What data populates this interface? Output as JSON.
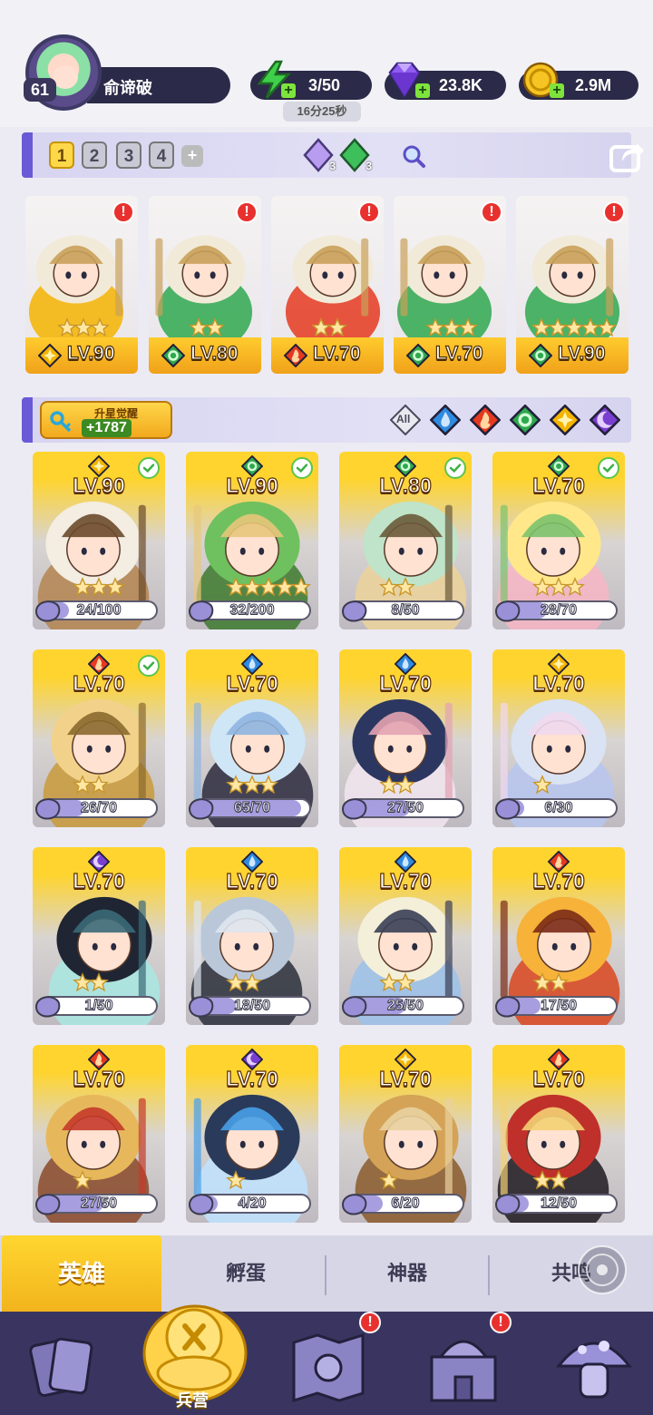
{
  "player": {
    "level": "61",
    "name": "俞谛破"
  },
  "resources": {
    "energy": "3/50",
    "energy_timer": "16分25秒",
    "gems": "23.8K",
    "gold": "2.9M"
  },
  "team_tabs": [
    "1",
    "2",
    "3",
    "4"
  ],
  "team_add_label": "+",
  "gem_badges": {
    "purple": "3",
    "green": "3"
  },
  "team": [
    {
      "level": "LV.90",
      "stars": 3,
      "element": "light"
    },
    {
      "level": "LV.80",
      "stars": 2,
      "element": "wind"
    },
    {
      "level": "LV.70",
      "stars": 2,
      "element": "fire"
    },
    {
      "level": "LV.70",
      "stars": 3,
      "element": "wind"
    },
    {
      "level": "LV.90",
      "stars": 5,
      "element": "wind"
    }
  ],
  "awaken": {
    "label": "升星觉醒",
    "value": "+1787"
  },
  "filter_all_label": "All",
  "heroes": [
    {
      "level": "LV.90",
      "shards": "24/100",
      "progress": 0.24,
      "element": "light",
      "check": true,
      "stars": 3,
      "palette": [
        "#f3ede2",
        "#b48550",
        "#6b4a2b"
      ]
    },
    {
      "level": "LV.90",
      "shards": "32/200",
      "progress": 0.16,
      "element": "wind",
      "check": true,
      "stars": 5,
      "palette": [
        "#6fc05e",
        "#3d7a2e",
        "#e7c77a"
      ]
    },
    {
      "level": "LV.80",
      "shards": "8/50",
      "progress": 0.16,
      "element": "wind",
      "check": true,
      "stars": 2,
      "palette": [
        "#bfe4c9",
        "#ecd29a",
        "#6a5a3a"
      ]
    },
    {
      "level": "LV.70",
      "shards": "28/70",
      "progress": 0.4,
      "element": "wind",
      "check": true,
      "stars": 3,
      "palette": [
        "#ffe78a",
        "#f7b6c4",
        "#7bc36b"
      ]
    },
    {
      "level": "LV.70",
      "shards": "26/70",
      "progress": 0.37,
      "element": "fire",
      "check": true,
      "stars": 2,
      "palette": [
        "#f2d28a",
        "#c99a3a",
        "#8b6a2d"
      ]
    },
    {
      "level": "LV.70",
      "shards": "65/70",
      "progress": 0.93,
      "element": "water",
      "check": false,
      "stars": 3,
      "palette": [
        "#cfe6f7",
        "#2c2a3d",
        "#8fb5e0"
      ]
    },
    {
      "level": "LV.70",
      "shards": "27/50",
      "progress": 0.54,
      "element": "water",
      "check": false,
      "stars": 2,
      "palette": [
        "#2b3760",
        "#f2e6f0",
        "#e3a3b3"
      ]
    },
    {
      "level": "LV.70",
      "shards": "6/30",
      "progress": 0.2,
      "element": "light",
      "check": false,
      "stars": 1,
      "palette": [
        "#d9e3f3",
        "#b7c6f0",
        "#f1d9ef"
      ]
    },
    {
      "level": "LV.70",
      "shards": "1/50",
      "progress": 0.02,
      "element": "dark",
      "check": false,
      "stars": 2,
      "palette": [
        "#1f2533",
        "#a8e8e2",
        "#3a6a77"
      ]
    },
    {
      "level": "LV.70",
      "shards": "18/50",
      "progress": 0.36,
      "element": "water",
      "check": false,
      "stars": 2,
      "palette": [
        "#b9c7d9",
        "#2a2f3a",
        "#dfe5ee"
      ]
    },
    {
      "level": "LV.70",
      "shards": "25/50",
      "progress": 0.5,
      "element": "water",
      "check": false,
      "stars": 2,
      "palette": [
        "#f4efd8",
        "#9cc2ea",
        "#3a3f56"
      ]
    },
    {
      "level": "LV.70",
      "shards": "17/50",
      "progress": 0.34,
      "element": "fire",
      "check": false,
      "stars": 2,
      "palette": [
        "#f7b23a",
        "#d9461e",
        "#7a2b16"
      ]
    },
    {
      "level": "LV.70",
      "shards": "27/50",
      "progress": 0.54,
      "element": "fire",
      "check": false,
      "stars": 1,
      "palette": [
        "#e7b85b",
        "#8a4a2a",
        "#c53a2a"
      ]
    },
    {
      "level": "LV.70",
      "shards": "4/20",
      "progress": 0.2,
      "element": "dark",
      "check": false,
      "stars": 1,
      "palette": [
        "#2a3a5a",
        "#bfe3ff",
        "#47a0e8"
      ]
    },
    {
      "level": "LV.70",
      "shards": "6/20",
      "progress": 0.3,
      "element": "light",
      "check": false,
      "stars": 1,
      "palette": [
        "#d4a357",
        "#8a5a2a",
        "#e9d2a0"
      ]
    },
    {
      "level": "LV.70",
      "shards": "12/50",
      "progress": 0.24,
      "element": "fire",
      "check": false,
      "stars": 2,
      "palette": [
        "#c0302a",
        "#1e1a20",
        "#f4d173"
      ]
    }
  ],
  "tabs": [
    "英雄",
    "孵蛋",
    "神器",
    "共鸣"
  ],
  "nav": {
    "barracks_label": "兵营"
  },
  "colors": {
    "light": "#f4b400",
    "wind": "#2fa84f",
    "fire": "#e53920",
    "water": "#2f8be0",
    "dark": "#7a3fd0",
    "accent": "#6a5ad7"
  }
}
